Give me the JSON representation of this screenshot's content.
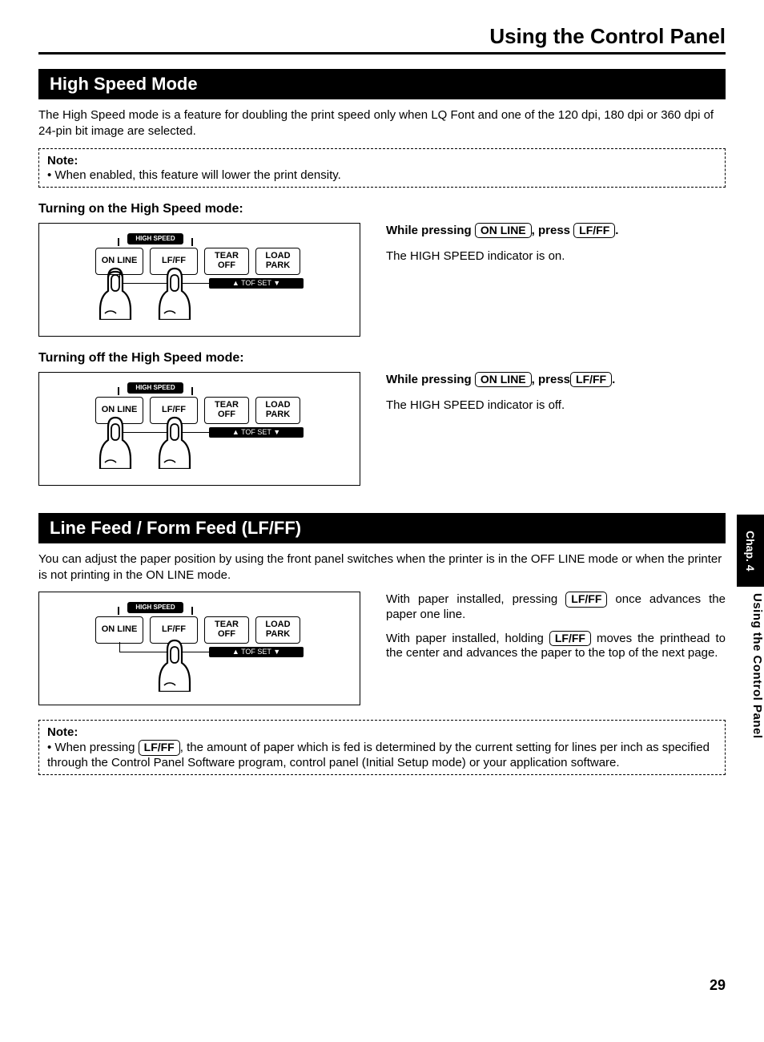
{
  "page": {
    "title": "Using the Control Panel",
    "number": "29"
  },
  "sideTab": {
    "chapter": "Chap. 4",
    "section": "Using the Control Panel"
  },
  "panelButtons": {
    "hsLabel": "HIGH SPEED",
    "online": "ON LINE",
    "lfff": "LF/FF",
    "tearoff_l1": "TEAR",
    "tearoff_l2": "OFF",
    "loadpark_l1": "LOAD",
    "loadpark_l2": "PARK",
    "tofset": "▲  TOF  SET  ▼"
  },
  "keys": {
    "online": "ON LINE",
    "lfff": "LF/FF"
  },
  "highSpeed": {
    "heading": "High Speed Mode",
    "intro": "The High Speed mode is a feature for doubling the print speed only when LQ Font and one of the 120 dpi, 180 dpi or 360 dpi of 24-pin bit image are selected.",
    "note": {
      "title": "Note:",
      "text": "When enabled, this feature will lower the print density."
    },
    "on": {
      "subheading": "Turning on the High Speed mode:",
      "instr_pre": "While pressing ",
      "instr_mid": ", press ",
      "instr_post": ".",
      "result": "The HIGH SPEED indicator is on."
    },
    "off": {
      "subheading": "Turning off the High Speed mode:",
      "instr_pre": "While pressing ",
      "instr_mid": ", press",
      "instr_post": ".",
      "result": "The HIGH SPEED indicator is off."
    }
  },
  "lineFeed": {
    "heading": "Line Feed / Form Feed (LF/FF)",
    "intro": "You can adjust the paper position by using the front panel switches when the printer is in the OFF LINE mode or when the printer is not printing in the ON LINE mode.",
    "p1_pre": "With paper installed, pressing ",
    "p1_post": " once advances the paper one line.",
    "p2_pre": "With paper installed, holding ",
    "p2_post": " moves the printhead to the center and advances the paper to the top of the next page.",
    "note": {
      "title": "Note:",
      "pre": "When pressing ",
      "post": ", the amount of paper which is fed is determined by the current setting for lines per inch as specified through the Control Panel Software program, control panel (Initial Setup mode) or your application software."
    }
  }
}
